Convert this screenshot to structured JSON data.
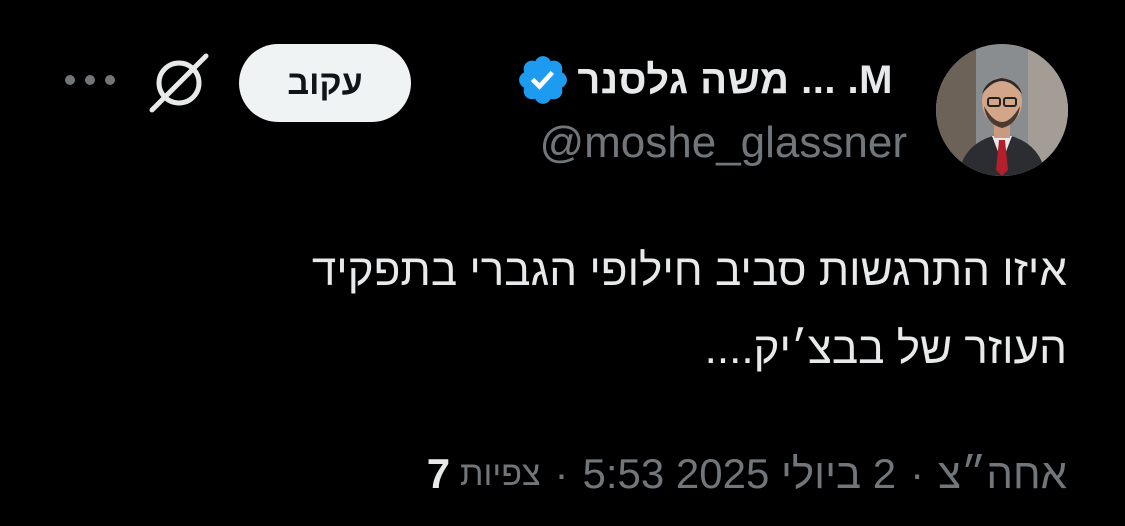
{
  "author": {
    "display_name": "M. ... משה גלסנר",
    "handle": "@moshe_glassner",
    "verified": true
  },
  "actions": {
    "follow_label": "עקוב"
  },
  "tweet": {
    "lines": [
      "איזו התרגשות סביב חילופי הגברי בתפקיד",
      "העוזר של בבצ׳יק...."
    ]
  },
  "meta": {
    "time": "אחה״צ",
    "separator": "·",
    "date": "2 ביולי 2025 5:53",
    "views_count": "7",
    "views_label": "צפיות"
  },
  "colors": {
    "background": "#000000",
    "text": "#e7e9ea",
    "secondary": "#71767b",
    "verified_blue": "#1d9bf0",
    "follow_bg": "#eff3f4"
  },
  "icons": {
    "verified": "verified-badge-icon",
    "grok": "grok-icon",
    "more": "more-horizontal-icon"
  }
}
